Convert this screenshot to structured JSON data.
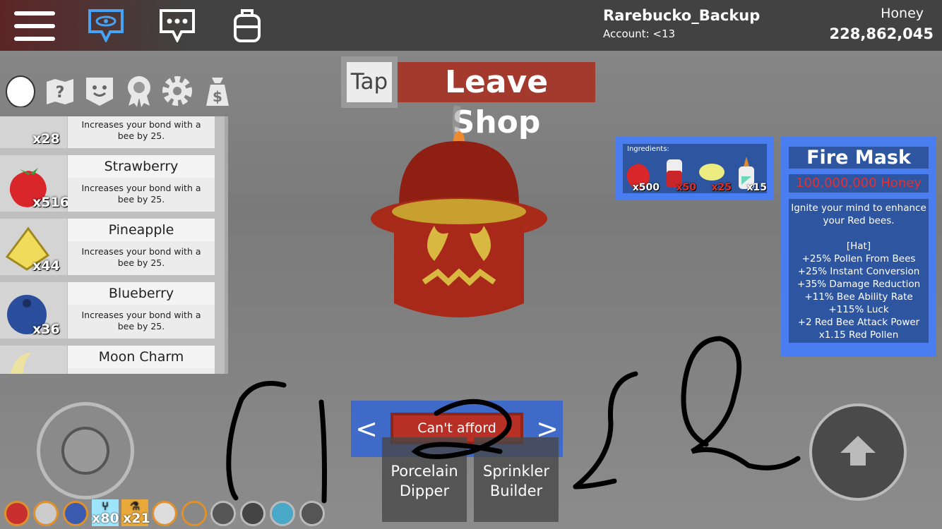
{
  "topbar": {
    "username": "Rarebucko_Backup",
    "account": "Account: <13",
    "honey_label": "Honey",
    "honey_value": "228,862,045",
    "icons": [
      "menu-icon",
      "chat-bubble-eye-icon",
      "chat-icon",
      "backpack-icon"
    ]
  },
  "menu_icons": [
    "egg-icon",
    "quest-map-icon",
    "bee-face-icon",
    "badge-icon",
    "gear-icon",
    "shop-bag-icon"
  ],
  "leave_shop": {
    "tap": "Tap",
    "label": "Leave Shop"
  },
  "items": [
    {
      "name": "",
      "desc": "Increases your bond with a bee by 25.",
      "count": "x28"
    },
    {
      "name": "Strawberry",
      "desc": "Increases your bond with a bee by 25.",
      "count": "x516"
    },
    {
      "name": "Pineapple",
      "desc": "Increases your bond with a bee by 25.",
      "count": "x44"
    },
    {
      "name": "Blueberry",
      "desc": "Increases your bond with a bee by 25.",
      "count": "x36"
    },
    {
      "name": "Moon Charm",
      "desc": "",
      "count": ""
    }
  ],
  "ingredients": {
    "label": "Ingredients:",
    "list": [
      {
        "icon": "strawberry-icon",
        "qty": "x500",
        "color": "#ffffff"
      },
      {
        "icon": "red-extract-icon",
        "qty": "x50",
        "color": "#e0302a"
      },
      {
        "icon": "ticket-icon",
        "qty": "x25",
        "color": "#e0302a"
      },
      {
        "icon": "glue-icon",
        "qty": "x15",
        "color": "#ffffff"
      }
    ]
  },
  "product": {
    "title": "Fire Mask",
    "price": "100,000,000 Honey",
    "description": "Ignite your mind to enhance your Red bees.",
    "type": "[Hat]",
    "stats": [
      "+25% Pollen From Bees",
      "+25% Instant Conversion",
      "+35% Damage Reduction",
      "+11% Bee Ability Rate",
      "+115% Luck",
      "+2 Red Bee Attack Power",
      "x1.15 Red Pollen"
    ]
  },
  "nav": {
    "prev": "<",
    "next": ">",
    "buy": "Can't afford"
  },
  "options": [
    "Porcelain Dipper",
    "Sprinkler Builder"
  ],
  "hotbar": {
    "treat_count": "x80",
    "enzyme_count": "x21"
  },
  "colors": {
    "accent_blue": "#4a7ef0",
    "panel_blue": "#2d55a0",
    "shop_red": "#a43a2e",
    "price_red": "#e53030"
  }
}
